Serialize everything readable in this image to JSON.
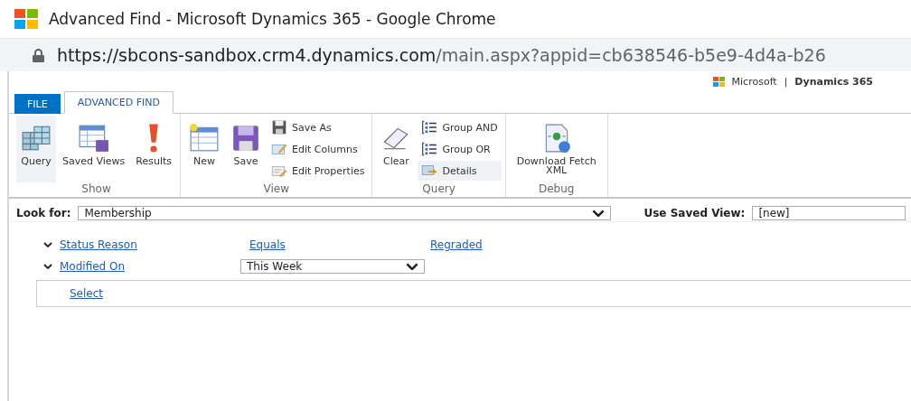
{
  "window": {
    "title": "Advanced Find - Microsoft Dynamics 365 - Google Chrome"
  },
  "address": {
    "host": "https://sbcons-sandbox.crm4.dynamics.com",
    "path": "/main.aspx?appid=cb638546-b5e9-4d4a-b26"
  },
  "brand": {
    "company": "Microsoft",
    "separator": "|",
    "product": "Dynamics 365"
  },
  "tabs": [
    {
      "label": "FILE",
      "kind": "file",
      "selected": false
    },
    {
      "label": "ADVANCED FIND",
      "kind": "tab",
      "selected": true
    }
  ],
  "ribbon": [
    {
      "name": "Show",
      "items": [
        {
          "kind": "large",
          "label": "Query",
          "selected": true
        },
        {
          "kind": "large",
          "label": "Saved Views",
          "selected": false
        },
        {
          "kind": "large",
          "label": "Results",
          "selected": false
        }
      ]
    },
    {
      "name": "View",
      "items": [
        {
          "kind": "large",
          "label": "New",
          "selected": false
        },
        {
          "kind": "large",
          "label": "Save",
          "selected": false
        },
        {
          "kind": "stack",
          "children": [
            {
              "label": "Save As",
              "selected": false
            },
            {
              "label": "Edit Columns",
              "selected": false
            },
            {
              "label": "Edit Properties",
              "selected": false
            }
          ]
        }
      ]
    },
    {
      "name": "Query",
      "items": [
        {
          "kind": "large",
          "label": "Clear",
          "selected": false
        },
        {
          "kind": "stack",
          "children": [
            {
              "label": "Group AND",
              "selected": false
            },
            {
              "label": "Group OR",
              "selected": false
            },
            {
              "label": "Details",
              "selected": true
            }
          ]
        }
      ]
    },
    {
      "name": "Debug",
      "items": [
        {
          "kind": "large",
          "label": "Download Fetch XML",
          "selected": false
        }
      ]
    }
  ],
  "look_for": {
    "label": "Look for:",
    "value": "Membership"
  },
  "saved_view": {
    "label": "Use Saved View:",
    "value": "[new]"
  },
  "conditions": [
    {
      "field": "Status Reason",
      "operator": "Equals",
      "value": "Regraded",
      "kind": "link"
    },
    {
      "field": "Modified On",
      "operator": "This Week",
      "kind": "dropdown"
    }
  ],
  "select_link": "Select"
}
